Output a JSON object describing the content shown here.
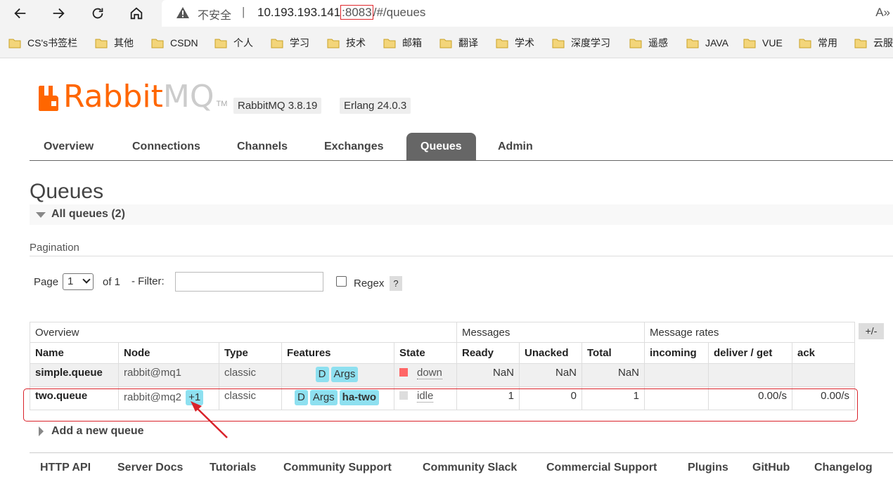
{
  "browser": {
    "not_secure": "不安全",
    "separator": "|",
    "url_host": "10.193.193.141",
    "url_port": ":8083",
    "url_path": "/#/queues",
    "reader_glyph": "A»"
  },
  "bookmarks": [
    "CS's书签栏",
    "其他",
    "CSDN",
    "个人",
    "学习",
    "技术",
    "邮箱",
    "翻译",
    "学术",
    "深度学习",
    "遥感",
    "JAVA",
    "VUE",
    "常用",
    "云服"
  ],
  "header": {
    "logo_rabbit": "Rabbit",
    "logo_mq": "MQ",
    "logo_tm": "TM",
    "version": "RabbitMQ 3.8.19",
    "erlang": "Erlang 24.0.3"
  },
  "tabs": [
    {
      "label": "Overview",
      "active": false
    },
    {
      "label": "Connections",
      "active": false
    },
    {
      "label": "Channels",
      "active": false
    },
    {
      "label": "Exchanges",
      "active": false
    },
    {
      "label": "Queues",
      "active": true
    },
    {
      "label": "Admin",
      "active": false
    }
  ],
  "page_title": "Queues",
  "section_title": "All queues (2)",
  "pagination": {
    "label": "Pagination",
    "page_label": "Page",
    "page_value": "1",
    "of_label": "of 1",
    "filter_label": "- Filter:",
    "filter_value": "",
    "regex_label": "Regex",
    "help": "?"
  },
  "table": {
    "groups": [
      "Overview",
      "Messages",
      "Message rates"
    ],
    "plus_minus": "+/-",
    "columns": [
      "Name",
      "Node",
      "Type",
      "Features",
      "State",
      "Ready",
      "Unacked",
      "Total",
      "incoming",
      "deliver / get",
      "ack"
    ],
    "rows": [
      {
        "name": "simple.queue",
        "node": "rabbit@mq1",
        "node_extra": "",
        "type": "classic",
        "features": [
          "D",
          "Args"
        ],
        "state": "down",
        "state_color": "#f66",
        "ready": "NaN",
        "unacked": "NaN",
        "total": "NaN",
        "incoming": "",
        "deliver": "",
        "ack": ""
      },
      {
        "name": "two.queue",
        "node": "rabbit@mq2",
        "node_extra": "+1",
        "type": "classic",
        "features": [
          "D",
          "Args",
          "ha-two"
        ],
        "state": "idle",
        "state_color": "#ddd",
        "ready": "1",
        "unacked": "0",
        "total": "1",
        "incoming": "",
        "deliver": "0.00/s",
        "ack": "0.00/s"
      }
    ]
  },
  "add_queue": "Add a new queue",
  "footer_links": [
    "HTTP API",
    "Server Docs",
    "Tutorials",
    "Community Support",
    "Community Slack",
    "Commercial Support",
    "Plugins",
    "GitHub",
    "Changelog"
  ],
  "colors": {
    "brand": "#ff6600",
    "feature_pill": "#8ee0f0",
    "highlight": "#d9222a"
  }
}
